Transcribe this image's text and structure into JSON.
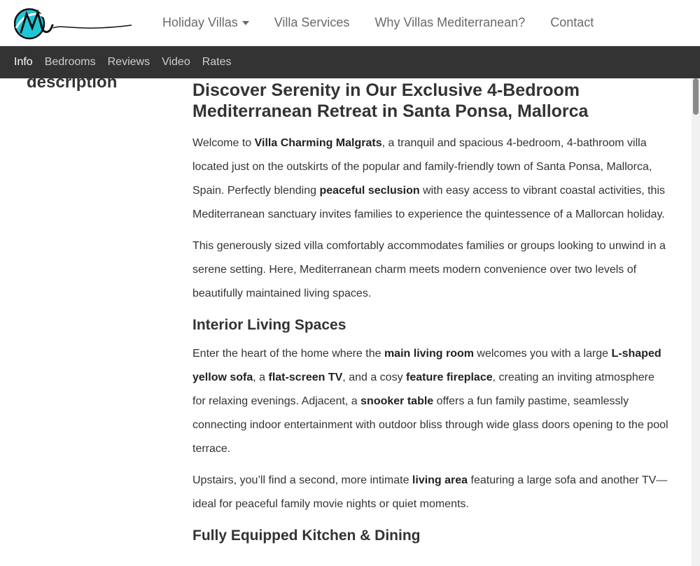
{
  "brand": {
    "name": "Mediterranean"
  },
  "main_nav": {
    "holiday_villas": "Holiday Villas",
    "villa_services": "Villa Services",
    "why": "Why Villas Mediterranean?",
    "contact": "Contact"
  },
  "sub_nav": {
    "info": "Info",
    "bedrooms": "Bedrooms",
    "reviews": "Reviews",
    "video": "Video",
    "rates": "Rates"
  },
  "side_label": "description",
  "article": {
    "title": "Discover Serenity in Our Exclusive 4-Bedroom Mediterranean Retreat in Santa Ponsa, Mallorca",
    "p1": {
      "a": "Welcome to ",
      "b": "Villa Charming Malgrats",
      "c": ", a tranquil and spacious 4-bedroom, 4-bathroom villa located just on the outskirts of the popular and family-friendly town of Santa Ponsa, Mallorca, Spain. Perfectly blending ",
      "d": "peaceful seclusion",
      "e": " with easy access to vibrant coastal activities, this Mediterranean sanctuary invites families to experience the quintessence of a Mallorcan holiday."
    },
    "p2": "This generously sized villa comfortably accommodates families or groups looking to unwind in a serene setting. Here, Mediterranean charm meets modern convenience over two levels of beautifully maintained living spaces.",
    "h_interior": "Interior Living Spaces",
    "p3": {
      "a": "Enter the heart of the home where the ",
      "b": "main living room",
      "c": " welcomes you with a large ",
      "d": "L-shaped yellow sofa",
      "e": ", a ",
      "f": "flat-screen TV",
      "g": ", and a cosy ",
      "h": "feature fireplace",
      "i": ", creating an inviting atmosphere for relaxing evenings. Adjacent, a ",
      "j": "snooker table",
      "k": " offers a fun family pastime, seamlessly connecting indoor entertainment with outdoor bliss through wide glass doors opening to the pool terrace."
    },
    "p4": {
      "a": "Upstairs, you’ll find a second, more intimate ",
      "b": "living area",
      "c": " featuring a large sofa and another TV—ideal for peaceful family movie nights or quiet moments."
    },
    "h_kitchen": "Fully Equipped Kitchen & Dining"
  },
  "colors": {
    "logo_accent": "#21c6d6",
    "subnav_bg": "#333333"
  }
}
